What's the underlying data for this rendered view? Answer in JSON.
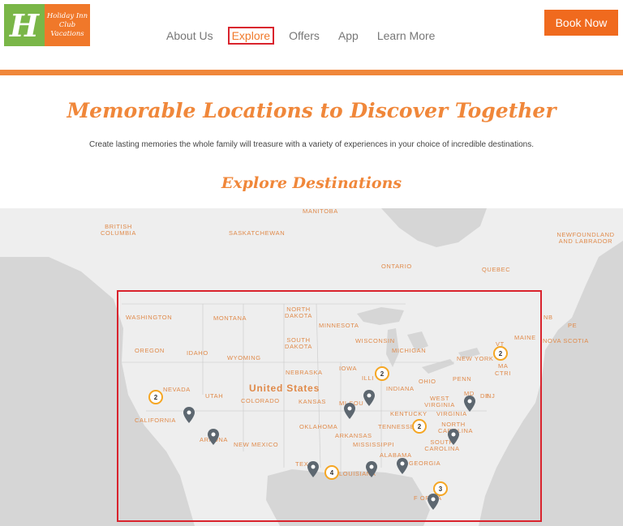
{
  "header": {
    "logo": {
      "lines": [
        "Holiday Inn",
        "Club",
        "Vacations"
      ]
    },
    "nav": [
      {
        "label": "About Us",
        "active": false
      },
      {
        "label": "Explore",
        "active": true
      },
      {
        "label": "Offers",
        "active": false
      },
      {
        "label": "App",
        "active": false
      },
      {
        "label": "Learn More",
        "active": false
      }
    ],
    "book_label": "Book Now"
  },
  "hero": {
    "title": "Memorable Locations to Discover Together",
    "subtitle": "Create lasting memories the whole family will treasure with a variety of experiences in your choice of incredible destinations."
  },
  "explore": {
    "title": "Explore Destinations"
  },
  "map": {
    "labels": {
      "manitoba": "MANITOBA",
      "british_columbia": "BRITISH COLUMBIA",
      "saskatchewan": "SASKATCHEWAN",
      "newfoundland": "NEWFOUNDLAND AND LABRADOR",
      "ontario": "ONTARIO",
      "quebec": "QUEBEC",
      "washington": "WASHINGTON",
      "montana": "MONTANA",
      "north_dakota": "NORTH DAKOTA",
      "minnesota": "MINNESOTA",
      "south_dakota": "SOUTH DAKOTA",
      "wisconsin": "WISCONSIN",
      "michigan": "MICHIGAN",
      "oregon": "OREGON",
      "idaho": "IDAHO",
      "wyoming": "WYOMING",
      "nebraska": "NEBRASKA",
      "iowa": "IOWA",
      "illinois": "ILLI",
      "new_york": "NEW YORK",
      "vt": "VT",
      "ma": "MA",
      "ctri": "CTRI",
      "maine": "MAINE",
      "nb": "NB",
      "pe": "PE",
      "nova_scotia": "NOVA SCOTIA",
      "nevada": "NEVADA",
      "utah": "UTAH",
      "colorado": "COLORADO",
      "united_states": "United States",
      "kansas": "KANSAS",
      "missouri": "MI SOU",
      "indiana": "INDIANA",
      "ohio": "OHIO",
      "penn": "PENN",
      "west_virginia": "WEST VIRGINIA",
      "md": "MD",
      "de": "DE",
      "nj": "NJ",
      "california": "CALIFORNIA",
      "arizona": "ARI ONA",
      "new_mexico": "NEW MEXICO",
      "oklahoma": "OKLAHOMA",
      "arkansas": "ARKANSAS",
      "tennessee": "TENNESSEE",
      "kentucky": "KENTUCKY",
      "virginia": "VIRGINIA",
      "north_carolina": "NORTH CAROLINA",
      "mississippi": "MISSISSIPPI",
      "alabama": "ALABAMA",
      "georgia": "GEORGIA",
      "south_carolina": "SOUTH CAROLINA",
      "texas": "TEX",
      "louisiana": "LOUISIANA",
      "florida": "F ORIDA"
    },
    "clusters": [
      {
        "id": "northeast",
        "count": "2"
      },
      {
        "id": "illinois",
        "count": "2"
      },
      {
        "id": "nevada",
        "count": "2"
      },
      {
        "id": "tennessee",
        "count": "2"
      },
      {
        "id": "texas-coast",
        "count": "4"
      },
      {
        "id": "florida",
        "count": "3"
      }
    ],
    "colors": {
      "land": "#eeeeee",
      "water": "#cfcfcf",
      "label": "#e08a4a",
      "pin": "#5d6770",
      "cluster_ring": "#f5a623",
      "selection": "#d9232d"
    }
  }
}
